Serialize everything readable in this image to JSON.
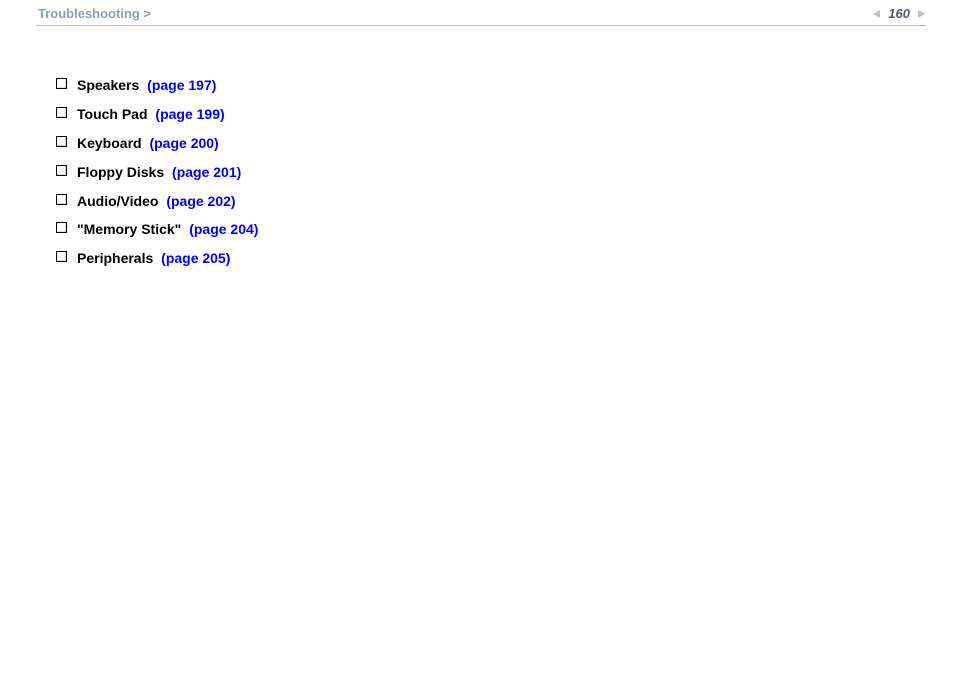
{
  "header": {
    "breadcrumb": "Troubleshooting >",
    "page_number": "160"
  },
  "content": {
    "items": [
      {
        "label": "Speakers",
        "link": "(page 197)"
      },
      {
        "label": "Touch Pad",
        "link": "(page 199)"
      },
      {
        "label": "Keyboard",
        "link": "(page 200)"
      },
      {
        "label": "Floppy Disks",
        "link": "(page 201)"
      },
      {
        "label": "Audio/Video",
        "link": "(page 202)"
      },
      {
        "label": "\"Memory Stick\"",
        "link": "(page 204)"
      },
      {
        "label": "Peripherals",
        "link": "(page 205)"
      }
    ]
  }
}
